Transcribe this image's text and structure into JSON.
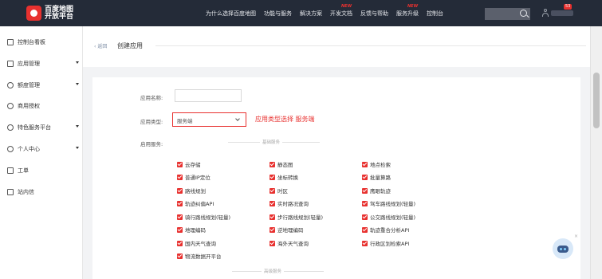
{
  "header": {
    "logo_line1": "百度地图",
    "logo_line2": "开放平台",
    "nav": [
      {
        "label": "为什么选择百度地图",
        "new": ""
      },
      {
        "label": "功能与服务",
        "new": ""
      },
      {
        "label": "解决方案",
        "new": ""
      },
      {
        "label": "开发文档",
        "new": "NEW"
      },
      {
        "label": "反馈与帮助",
        "new": ""
      },
      {
        "label": "服务升级",
        "new": "NEW"
      },
      {
        "label": "控制台",
        "new": ""
      }
    ],
    "badge": "53"
  },
  "sidebar": {
    "items": [
      {
        "label": "控制台看板",
        "arrow": false
      },
      {
        "label": "应用管理",
        "arrow": true
      },
      {
        "label": "额度管理",
        "arrow": true
      },
      {
        "label": "商用授权",
        "arrow": false
      },
      {
        "label": "特色服务平台",
        "arrow": true
      },
      {
        "label": "个人中心",
        "arrow": true
      },
      {
        "label": "工单",
        "arrow": false
      },
      {
        "label": "站内信",
        "arrow": false
      }
    ]
  },
  "breadcrumb": {
    "back": "返回",
    "title": "创建应用"
  },
  "form": {
    "name_label": "应用名称:",
    "name_value": "",
    "type_label": "应用类型:",
    "type_value": "服务端",
    "annotation": "应用类型选择 服务端",
    "services_label": "启用服务:",
    "basic_section": "基础服务",
    "advanced_section": "高级服务",
    "services": [
      [
        "云存储",
        "静态图",
        "地点检索"
      ],
      [
        "普通IP定位",
        "坐标转换",
        "批量算路"
      ],
      [
        "路线规划",
        "时区",
        "鹰眼轨迹"
      ],
      [
        "轨迹纠偏API",
        "实时路况查询",
        "驾车路线规划(轻量)"
      ],
      [
        "骑行路线规划(轻量)",
        "步行路线规划(轻量)",
        "公交路线规划(轻量)"
      ],
      [
        "地理编码",
        "逆地理编码",
        "轨迹重合分析API"
      ],
      [
        "国内天气查询",
        "海外天气查询",
        "行政区划检索API"
      ],
      [
        "物流数据开平台",
        "",
        ""
      ]
    ]
  },
  "colors": {
    "accent": "#e8312f",
    "header_bg": "#242b38"
  }
}
